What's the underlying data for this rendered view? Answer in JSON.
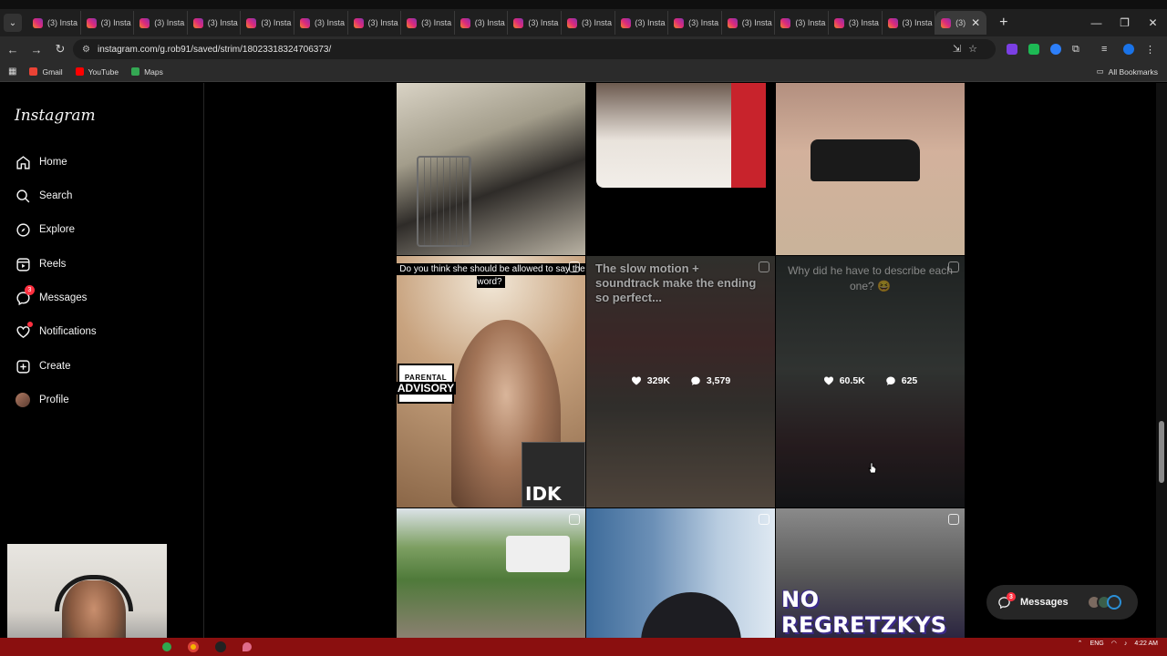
{
  "browser": {
    "tab_title": "(3) Insta",
    "active_tab_title": "(3)",
    "tab_count": 18,
    "new_tab_label": "+",
    "url": "instagram.com/g.rob91/saved/strim/18023318324706373/",
    "bookmarks": [
      {
        "label": "Gmail",
        "color": "#ea4335"
      },
      {
        "label": "YouTube",
        "color": "#ff0000"
      },
      {
        "label": "Maps",
        "color": "#34a853"
      }
    ],
    "all_bookmarks_label": "All Bookmarks"
  },
  "instagram": {
    "logo": "Instagram",
    "nav": [
      {
        "label": "Home",
        "icon": "home-icon"
      },
      {
        "label": "Search",
        "icon": "search-icon"
      },
      {
        "label": "Explore",
        "icon": "compass-icon"
      },
      {
        "label": "Reels",
        "icon": "reels-icon"
      },
      {
        "label": "Messages",
        "icon": "messenger-icon",
        "badge": "3"
      },
      {
        "label": "Notifications",
        "icon": "heart-icon",
        "dot": true
      },
      {
        "label": "Create",
        "icon": "plus-square-icon"
      },
      {
        "label": "Profile",
        "icon": "avatar"
      }
    ],
    "posts": [
      {
        "caption": ""
      },
      {
        "caption": ""
      },
      {
        "caption": ""
      },
      {
        "caption": "Do you think she should be allowed to say the word?",
        "sticker_label": "PARENTAL ADVISORY",
        "sticker_top": "PARENTAL",
        "sticker_bottom": "ADVISORY",
        "overlay_text": "IDK"
      },
      {
        "caption": "The slow motion + soundtrack make the ending so perfect...",
        "likes": "329K",
        "comments": "3,579"
      },
      {
        "caption": "Why did he have to describe each one? 😆",
        "likes": "60.5K",
        "comments": "625"
      },
      {
        "caption": ""
      },
      {
        "caption": ""
      },
      {
        "caption": "",
        "overlay_text": "NO REGRETZKYS"
      }
    ],
    "messages_pill": {
      "label": "Messages",
      "badge": "3"
    }
  },
  "taskbar": {
    "language": "ENG",
    "time": "4:22 AM"
  },
  "colors": {
    "accent_badge": "#ff3040",
    "page_bg": "#000000",
    "taskbar": "#8a0f0f"
  }
}
